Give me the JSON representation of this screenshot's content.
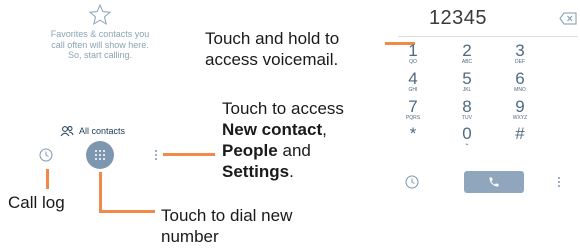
{
  "left_screen": {
    "empty_message": "Favorites & contacts you\ncall often will show here.\nSo, start calling.",
    "all_contacts_label": "All contacts"
  },
  "annotations": {
    "voicemail": "Touch and hold to access voicemail.",
    "new_contact_prefix": "Touch to access",
    "new_contact_bold": "New contact",
    "new_contact_sep": ",",
    "people_bold": "People",
    "and_word": "and",
    "settings_bold": "Settings",
    "period": ".",
    "call_log": "Call log",
    "dial_new": "Touch to dial new number"
  },
  "dialer": {
    "number": "12345",
    "keys": [
      {
        "digit": "1",
        "letters": "QO"
      },
      {
        "digit": "2",
        "letters": "ABC"
      },
      {
        "digit": "3",
        "letters": "DEF"
      },
      {
        "digit": "4",
        "letters": "GHI"
      },
      {
        "digit": "5",
        "letters": "JKL"
      },
      {
        "digit": "6",
        "letters": "MNO"
      },
      {
        "digit": "7",
        "letters": "PQRS"
      },
      {
        "digit": "8",
        "letters": "TUV"
      },
      {
        "digit": "9",
        "letters": "WXYZ"
      },
      {
        "digit": "*",
        "letters": ""
      },
      {
        "digit": "0",
        "letters": "+"
      },
      {
        "digit": "#",
        "letters": ""
      }
    ]
  },
  "colors": {
    "accent_orange": "#f0894a",
    "dial_button": "#7e97b0",
    "call_button": "#8fa6bd"
  },
  "icons": [
    "star-icon",
    "contacts-icon",
    "clock-icon",
    "dialpad-icon",
    "more-vert-icon",
    "backspace-icon",
    "phone-icon"
  ]
}
